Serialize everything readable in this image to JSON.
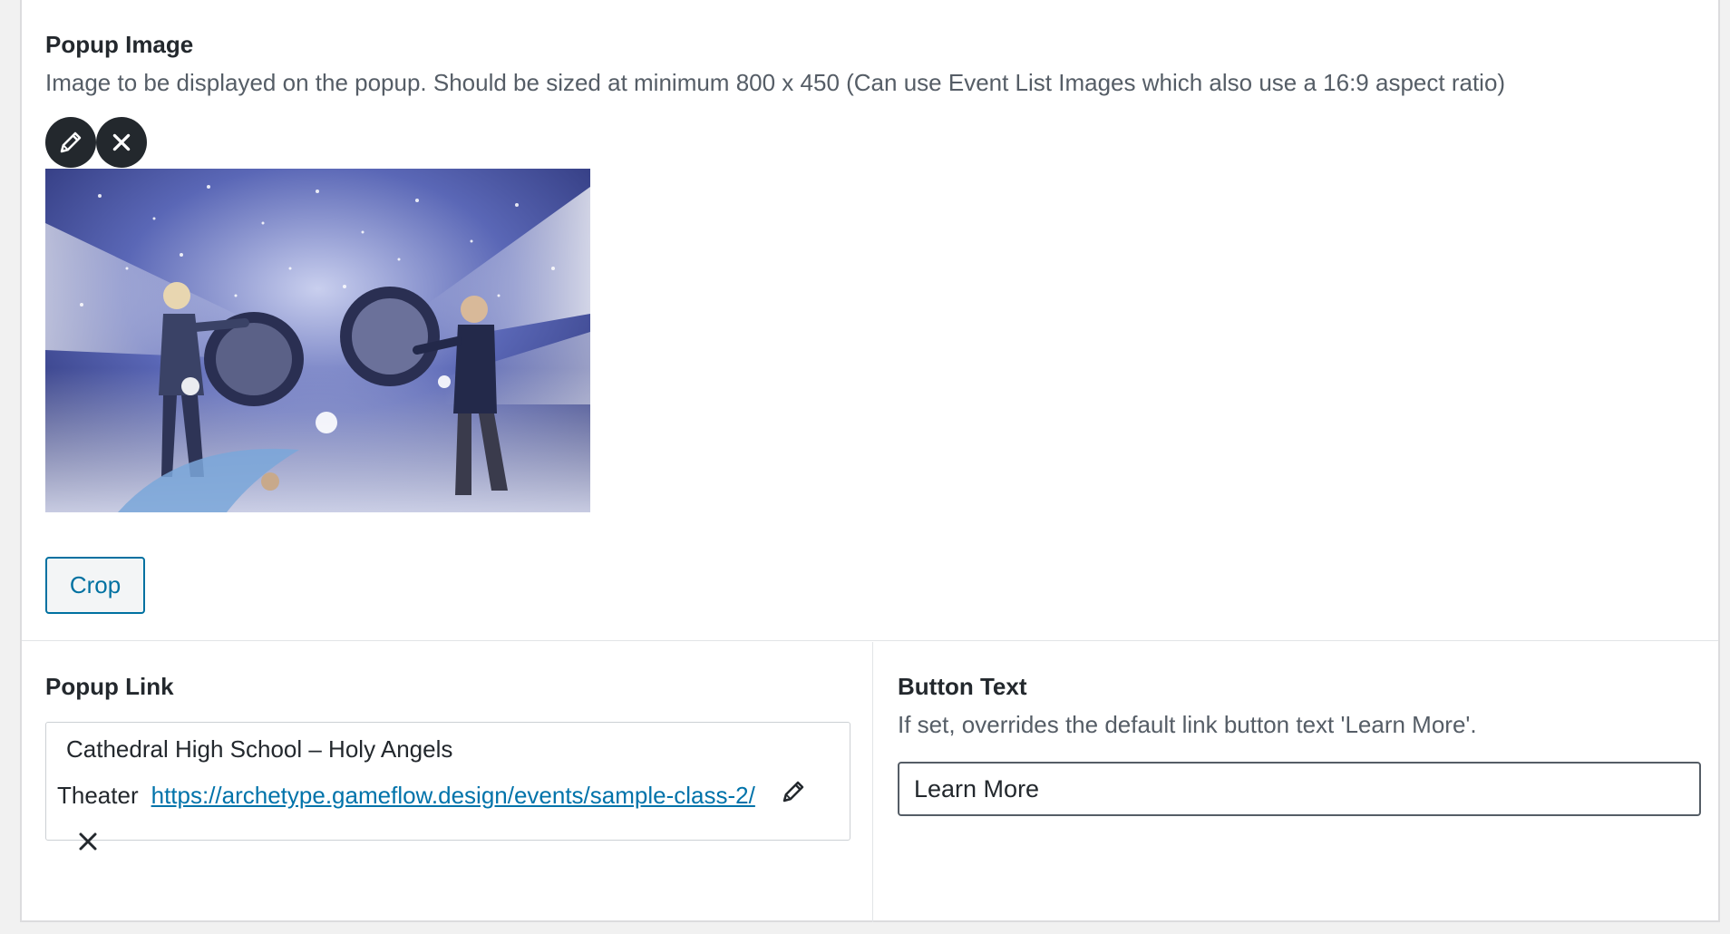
{
  "popup_image": {
    "label": "Popup Image",
    "description": "Image to be displayed on the popup. Should be sized at minimum 800 x 450 (Can use Event List Images which also use a 16:9 aspect ratio)",
    "edit_icon": "pencil-icon",
    "remove_icon": "close-icon",
    "crop_label": "Crop"
  },
  "popup_link": {
    "label": "Popup Link",
    "title": "Cathedral High School – Holy Angels Theater",
    "url": "https://archetype.gameflow.design/events/sample-class-2/",
    "edit_icon": "pencil-icon",
    "remove_icon": "close-icon"
  },
  "button_text": {
    "label": "Button Text",
    "description": "If set, overrides the default link button text 'Learn More'.",
    "value": "Learn More"
  },
  "colors": {
    "accent": "#0071a1",
    "link": "#0073aa",
    "dark_button": "#23282d"
  }
}
